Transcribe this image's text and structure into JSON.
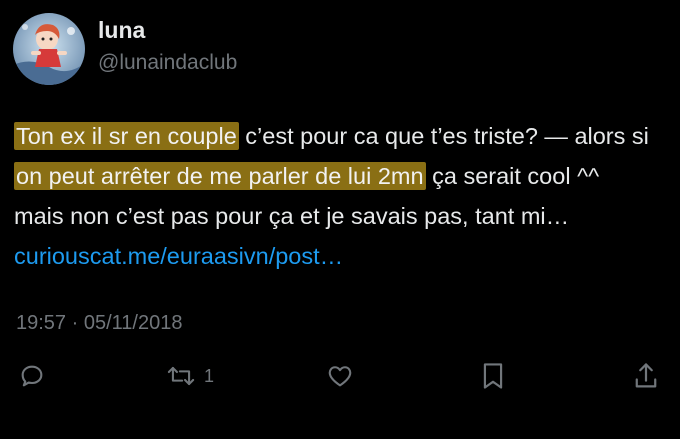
{
  "user": {
    "display_name": "luna",
    "handle": "@lunaindaclub",
    "avatar_icon": "anime-girl-avatar"
  },
  "tweet": {
    "hl1": "Ton ex il sr en couple",
    "seg1": " c’est pour ca que t’es triste? — alors si ",
    "hl2": "on peut arrêter de me parler de lui 2mn",
    "seg2": " ça serait cool ^^ mais non c’est pas pour ça et je savais pas, tant mi… ",
    "link": "curiouscat.me/euraasivn/post…",
    "timestamp": "19:57 · 05/11/2018"
  },
  "actions": {
    "reply_icon": "reply-icon",
    "retweet_icon": "retweet-icon",
    "retweet_count": "1",
    "like_icon": "heart-icon",
    "bookmark_icon": "bookmark-icon",
    "share_icon": "share-icon"
  },
  "colors": {
    "background": "#000000",
    "text": "#e7e9ea",
    "secondary": "#71767b",
    "link": "#1d9bf0",
    "highlight": "#8a6f14"
  }
}
